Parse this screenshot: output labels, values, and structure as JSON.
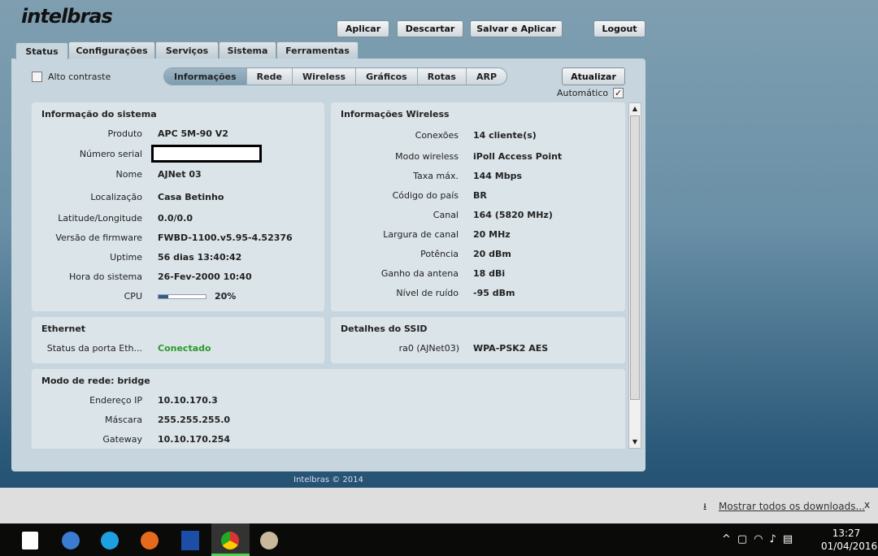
{
  "brand": "intelbras",
  "header": {
    "apply": "Aplicar",
    "discard": "Descartar",
    "save_apply": "Salvar e Aplicar",
    "logout": "Logout"
  },
  "tabs": [
    "Status",
    "Configurações",
    "Serviços",
    "Sistema",
    "Ferramentas"
  ],
  "subtabs": [
    "Informações",
    "Rede",
    "Wireless",
    "Gráficos",
    "Rotas",
    "ARP"
  ],
  "high_contrast": "Alto contraste",
  "refresh": "Atualizar",
  "automatic": "Automático",
  "system": {
    "title": "Informação do sistema",
    "rows": [
      {
        "label": "Produto",
        "value": "APC 5M-90 V2"
      },
      {
        "label": "Número serial",
        "value": ""
      },
      {
        "label": "Nome",
        "value": "AJNet 03"
      },
      {
        "label": "Localização",
        "value": "Casa Betinho"
      },
      {
        "label": "Latitude/Longitude",
        "value": "0.0/0.0"
      },
      {
        "label": "Versão de firmware",
        "value": "FWBD-1100.v5.95-4.52376"
      },
      {
        "label": "Uptime",
        "value": "56 dias 13:40:42"
      },
      {
        "label": "Hora do sistema",
        "value": "26-Fev-2000 10:40"
      },
      {
        "label": "CPU",
        "value": "20%"
      }
    ],
    "cpu_percent": 20
  },
  "wireless": {
    "title": "Informações Wireless",
    "rows": [
      {
        "label": "Conexões",
        "value": "14 cliente(s)"
      },
      {
        "label": "Modo wireless",
        "value": "iPoll Access Point"
      },
      {
        "label": "Taxa máx.",
        "value": "144 Mbps"
      },
      {
        "label": "Código do país",
        "value": "BR"
      },
      {
        "label": "Canal",
        "value": "164 (5820 MHz)"
      },
      {
        "label": "Largura de canal",
        "value": "20 MHz"
      },
      {
        "label": "Potência",
        "value": "20 dBm"
      },
      {
        "label": "Ganho da antena",
        "value": "18 dBi"
      },
      {
        "label": "Nível de ruído",
        "value": "-95 dBm"
      }
    ]
  },
  "ethernet": {
    "title": "Ethernet",
    "label": "Status da porta Eth...",
    "value": "Conectado"
  },
  "ssid": {
    "title": "Detalhes do SSID",
    "label": "ra0 (AJNet03)",
    "value": "WPA-PSK2 AES"
  },
  "network": {
    "title": "Modo de rede: bridge",
    "rows": [
      {
        "label": "Endereço IP",
        "value": "10.10.170.3"
      },
      {
        "label": "Máscara",
        "value": "255.255.255.0"
      },
      {
        "label": "Gateway",
        "value": "10.10.170.254"
      }
    ]
  },
  "footer": "Intelbras © 2014",
  "downloads": {
    "link": "Mostrar todos os downloads...",
    "close": "x"
  },
  "taskbar": {
    "time": "13:27",
    "date": "01/04/2016"
  }
}
